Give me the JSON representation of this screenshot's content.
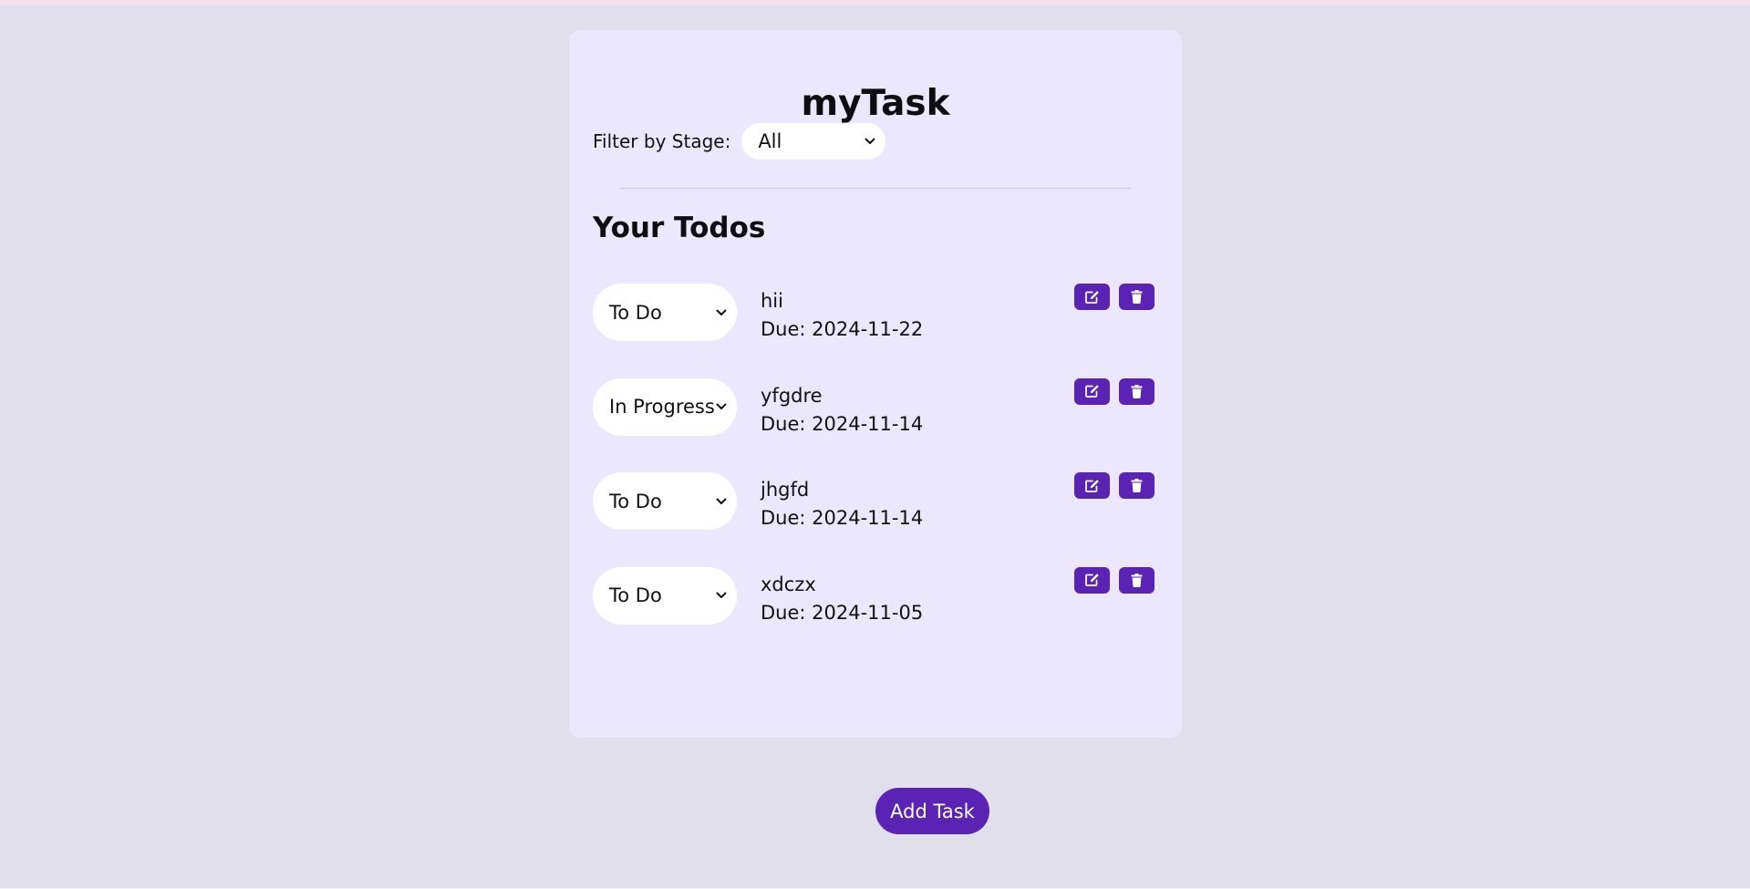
{
  "app": {
    "title": "myTask"
  },
  "filter": {
    "label": "Filter by Stage:",
    "selected": "All"
  },
  "section": {
    "title": "Your Todos"
  },
  "todos": [
    {
      "stage": "To Do",
      "title": "hii",
      "due": "Due: 2024-11-22"
    },
    {
      "stage": "In Progress",
      "title": "yfgdre",
      "due": "Due: 2024-11-14"
    },
    {
      "stage": "To Do",
      "title": "jhgfd",
      "due": "Due: 2024-11-14"
    },
    {
      "stage": "To Do",
      "title": "xdczx",
      "due": "Due: 2024-11-05"
    }
  ],
  "actions": {
    "add_label": "Add Task",
    "edit_icon": "edit-icon",
    "delete_icon": "trash-icon"
  },
  "colors": {
    "background": "#e1dfec",
    "card": "#ebe8fd",
    "accent": "#5b23b3",
    "control": "#ffffff"
  }
}
